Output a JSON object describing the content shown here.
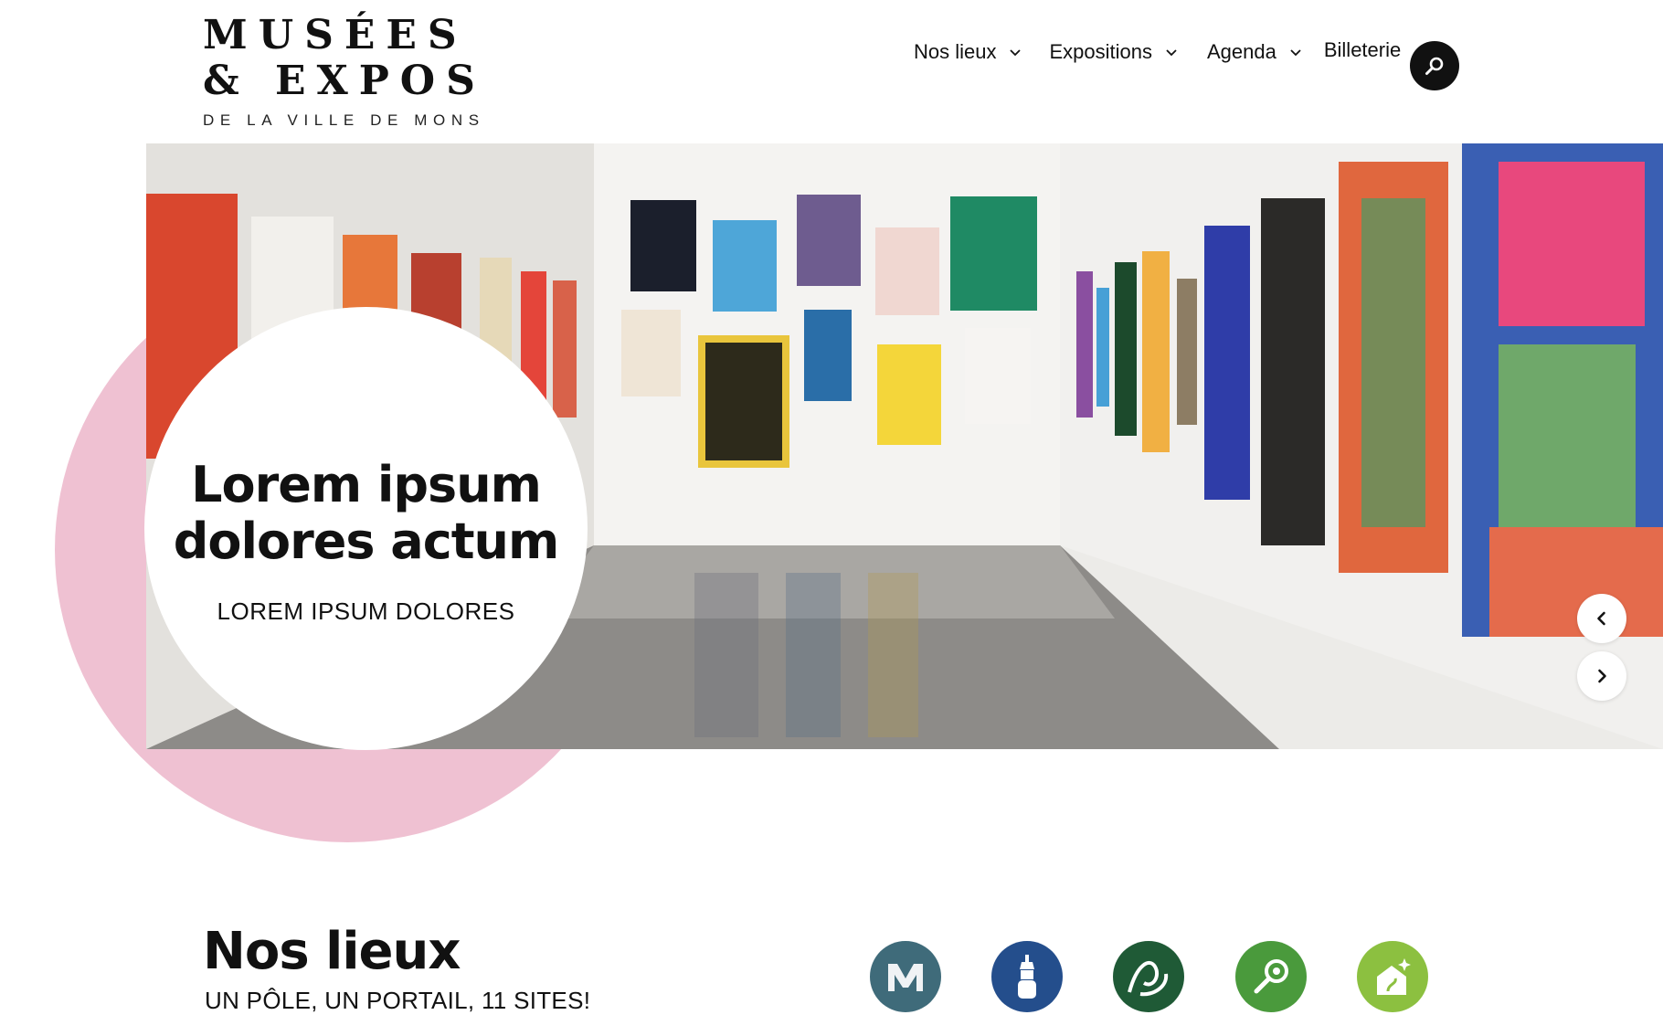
{
  "header": {
    "logo": {
      "line1": "MUSÉES",
      "line2": "& EXPOS",
      "line3": "DE LA VILLE DE MONS"
    },
    "nav": [
      {
        "label": "Nos lieux",
        "has_dropdown": true
      },
      {
        "label": "Expositions",
        "has_dropdown": true
      },
      {
        "label": "Agenda",
        "has_dropdown": true
      },
      {
        "label": "Billeterie",
        "has_dropdown": false
      }
    ],
    "search_icon": "search-icon"
  },
  "hero": {
    "title": "Lorem ipsum dolores actum",
    "subtitle": "LOREM IPSUM DOLORES",
    "prev_icon": "chevron-left-icon",
    "next_icon": "chevron-right-icon",
    "accent_color": "#efc1d2"
  },
  "places": {
    "title": "Nos lieux",
    "subtitle": "UN PÔLE, UN PORTAIL, 11 SITES!",
    "venues": [
      {
        "icon": "museum-m-icon",
        "color": "#3f6b7a"
      },
      {
        "icon": "belfry-icon",
        "color": "#244e8c"
      },
      {
        "icon": "ribbon-icon",
        "color": "#1f5a36"
      },
      {
        "icon": "magnifier-icon",
        "color": "#4a9a3c"
      },
      {
        "icon": "house-sparkle-icon",
        "color": "#8cc040"
      }
    ]
  }
}
